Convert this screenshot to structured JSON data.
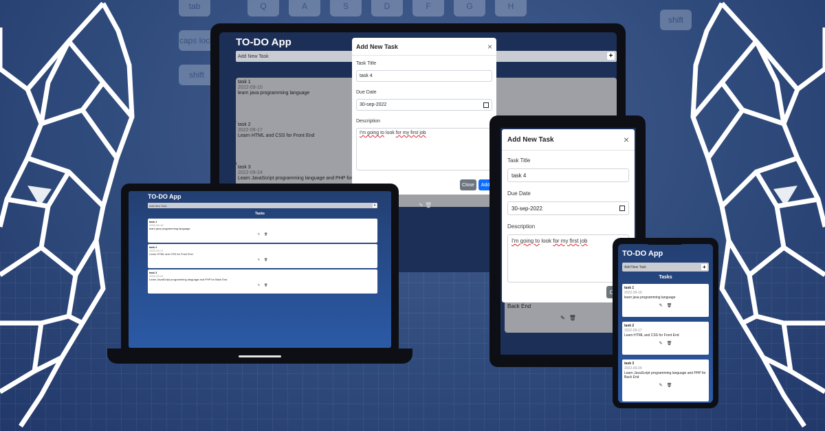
{
  "app": {
    "title": "TO-DO App",
    "add_new_task_placeholder": "Add New Task",
    "tasks_heading": "Tasks",
    "plus_symbol": "+",
    "edit_icon": "✎",
    "delete_icon": "🗑"
  },
  "tasks": [
    {
      "title": "task 1",
      "date": "2022-09-10",
      "description": "learn java programming language"
    },
    {
      "title": "task 2",
      "date": "2022-09-17",
      "description": "Learn HTML and CSS for Front End"
    },
    {
      "title": "task 3",
      "date": "2022-09-24",
      "description": "Learn JavaScript programming language and PHP for Back End"
    }
  ],
  "desktop_visible_tasks": [
    {
      "title": "task 1",
      "date": "2022-09-10",
      "description": "learn java programming language"
    },
    {
      "title": "task 2",
      "date": "2022-09-17",
      "description": "Learn HTML and CSS for Front End"
    },
    {
      "title": "task 3",
      "date": "2022-09-24",
      "description": "Learn JavaScript programming language and PHP for B"
    }
  ],
  "tablet_visible_text": "Back End",
  "modal": {
    "title": "Add New Task",
    "close_x": "×",
    "task_title_label": "Task Title",
    "task_title_value": "task 4",
    "due_date_label": "Due Date",
    "due_date_value": "30-sep-2022",
    "description_label": "Description",
    "description_prefix": "I'm going to",
    "description_mid": " look ",
    "description_suffix": "for my first job",
    "close_button": "Close",
    "add_button": "Add"
  },
  "keyboard_keys": [
    "tab",
    "caps lock",
    "shift",
    "fn",
    "Q",
    "A",
    "S",
    "D",
    "F",
    "G",
    "H",
    "shift"
  ],
  "colors": {
    "background": "#2b4777",
    "device_frame": "#0d0f14",
    "app_bg": "#1c2f57",
    "primary_button": "#0d6efd",
    "secondary_button": "#6c757d"
  }
}
